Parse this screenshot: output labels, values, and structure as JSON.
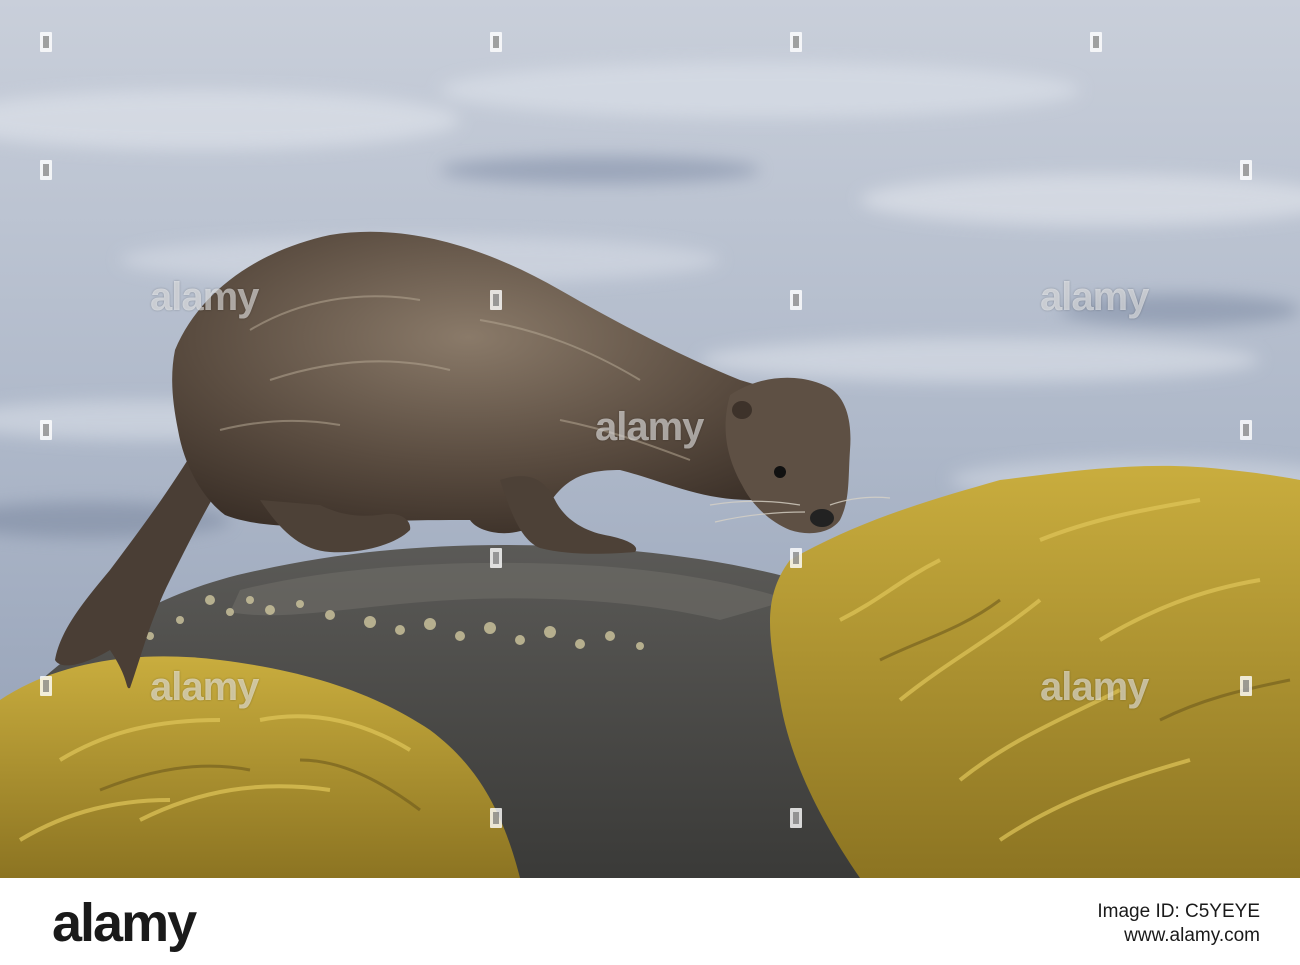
{
  "photo": {
    "subject": "otter-on-seaweed-rock",
    "colors": {
      "water": "#a9b4c6",
      "otter": "#5a4c40",
      "rock": "#4b4a48",
      "seaweed": "#b49a33"
    }
  },
  "watermark": {
    "text": "alamy"
  },
  "footer": {
    "logo": "alamy",
    "image_id_line1": "Image ID: C5YEYE",
    "image_id_line2": "www.alamy.com"
  }
}
